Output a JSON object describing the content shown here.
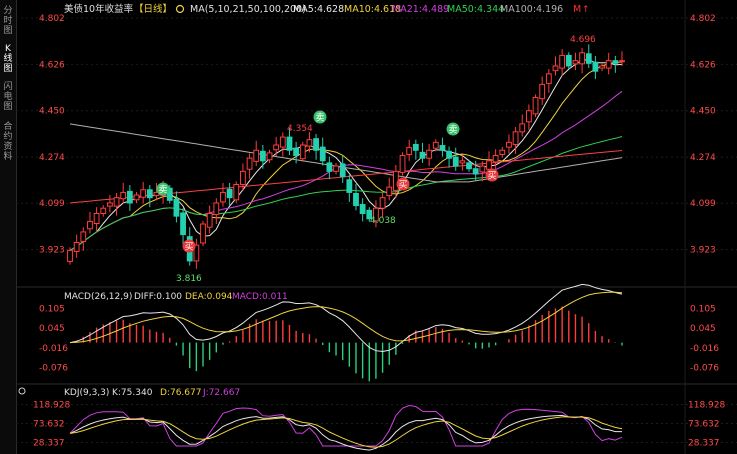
{
  "sidebar": {
    "tabs": [
      {
        "label": "分时图",
        "active": false
      },
      {
        "label": "K线图",
        "active": true
      },
      {
        "label": "闪电图",
        "active": false
      },
      {
        "label": "合约资料",
        "active": false
      }
    ]
  },
  "header": {
    "instrument": "美债10年收益率",
    "period": "【日线】",
    "ma_params": "MA(5,10,21,50,100,200)",
    "ma_values": [
      {
        "label": "MA5:4.628",
        "color": "#e8e8e8"
      },
      {
        "label": "MA10:4.618",
        "color": "#f0d23c"
      },
      {
        "label": "MA21:4.489",
        "color": "#d040e0"
      },
      {
        "label": "MA50:4.344",
        "color": "#30d050"
      },
      {
        "label": "MA100:4.196",
        "color": "#b0b0b0"
      }
    ],
    "m_label": "M"
  },
  "main_axis": {
    "ticks": [
      "4.802",
      "4.626",
      "4.450",
      "4.274",
      "4.099",
      "3.923"
    ],
    "min": 3.8,
    "max": 4.802
  },
  "annotations": {
    "high_left": "3.816",
    "high_mid": "4.354",
    "low_mid": "4.038",
    "high_right": "4.696",
    "sell_label": "卖",
    "buy_label": "买"
  },
  "macd": {
    "title": "MACD(26,12,9)",
    "diff": "DIFF:0.100",
    "dea": "DEA:0.094",
    "macd": "MACD:0.011",
    "ticks": [
      "0.105",
      "0.045",
      "-0.016",
      "-0.076"
    ]
  },
  "kdj": {
    "title": "KDJ(9,3,3)",
    "k": "K:75.340",
    "d": "D:76.677",
    "j": "J:72.667",
    "ticks": [
      "118.928",
      "73.632",
      "28.337"
    ]
  },
  "colors": {
    "up": "#ff3d3d",
    "down": "#25d0b0",
    "ma5": "#e8e8e8",
    "ma10": "#f0d23c",
    "ma21": "#d040e0",
    "ma50": "#30d050",
    "ma100": "#b0b0b0",
    "ma200": "#ff4040"
  },
  "chart_data": {
    "type": "candlestick",
    "closes": [
      3.92,
      3.95,
      3.99,
      4.03,
      4.06,
      4.08,
      4.1,
      4.12,
      4.14,
      4.1,
      4.13,
      4.15,
      4.12,
      4.14,
      4.16,
      4.11,
      4.05,
      3.98,
      3.88,
      3.94,
      4.02,
      4.06,
      4.1,
      4.14,
      4.12,
      4.17,
      4.22,
      4.27,
      4.3,
      4.26,
      4.29,
      4.32,
      4.35,
      4.3,
      4.28,
      4.32,
      4.34,
      4.3,
      4.26,
      4.22,
      4.24,
      4.2,
      4.14,
      4.09,
      4.06,
      4.04,
      4.08,
      4.12,
      4.16,
      4.22,
      4.28,
      4.31,
      4.3,
      4.27,
      4.3,
      4.33,
      4.3,
      4.27,
      4.24,
      4.26,
      4.23,
      4.21,
      4.24,
      4.26,
      4.28,
      4.3,
      4.33,
      4.37,
      4.4,
      4.45,
      4.5,
      4.55,
      4.59,
      4.62,
      4.66,
      4.62,
      4.64,
      4.67,
      4.63,
      4.6,
      4.62,
      4.64,
      4.63,
      4.64
    ]
  }
}
